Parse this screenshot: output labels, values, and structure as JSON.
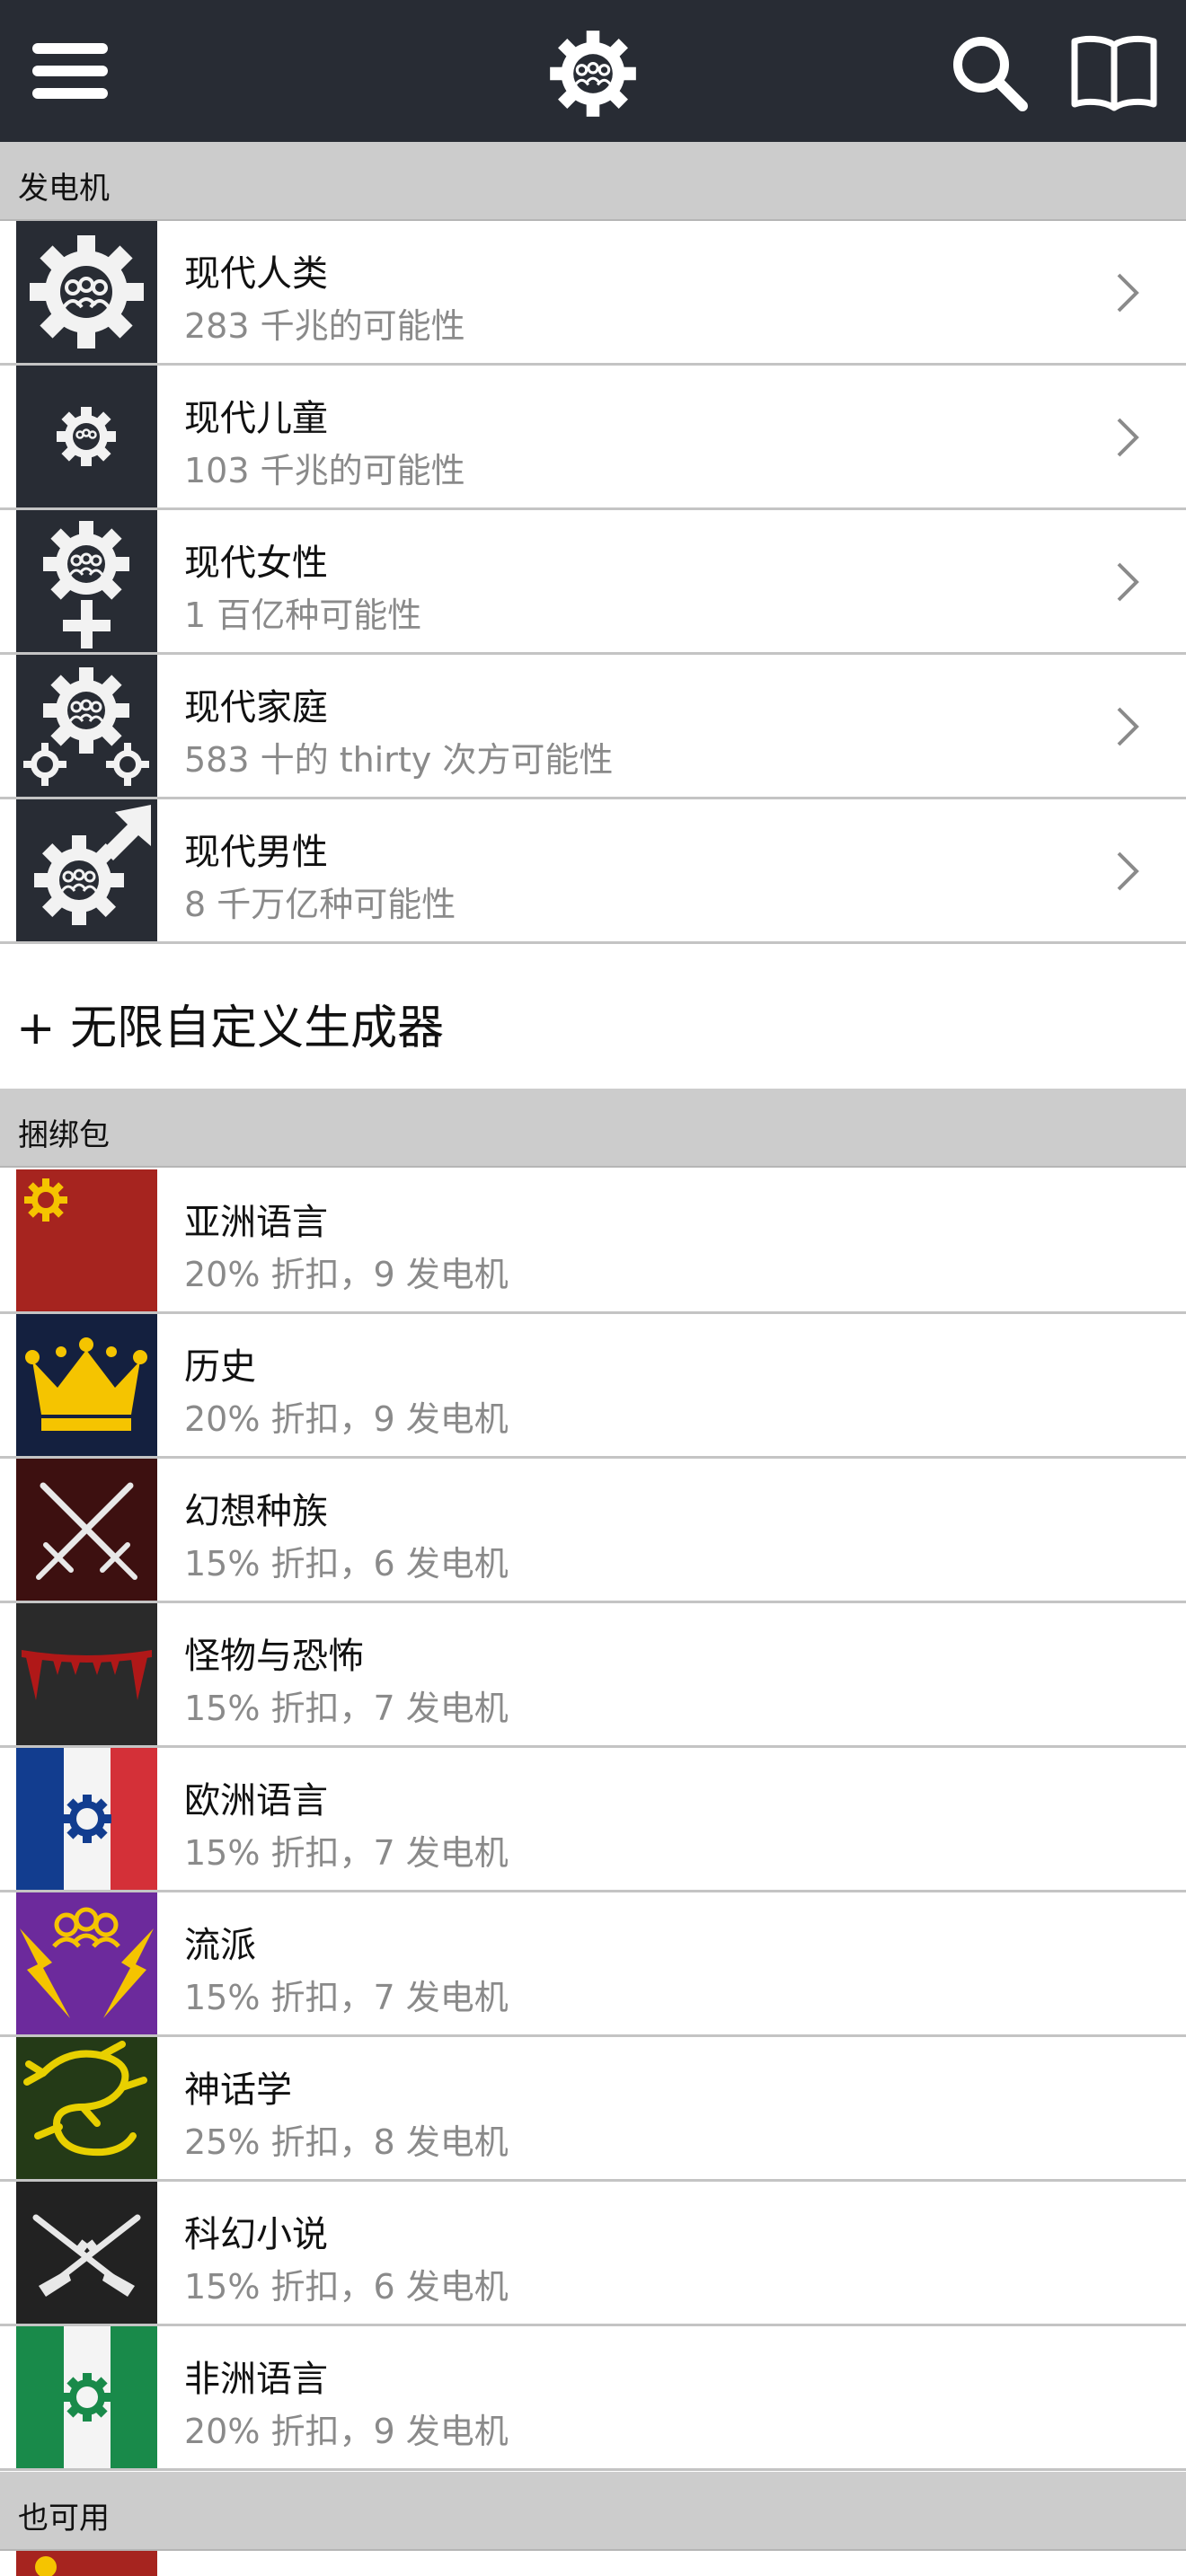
{
  "sections": {
    "generators": "发电机",
    "bundles": "捆绑包",
    "also_available": "也可用"
  },
  "generators": [
    {
      "title": "现代人类",
      "subtitle": "283 千兆的可能性",
      "icon": "gear-people-icon"
    },
    {
      "title": "现代儿童",
      "subtitle": "103 千兆的可能性",
      "icon": "small-gear-icon"
    },
    {
      "title": "现代女性",
      "subtitle": "1 百亿种可能性",
      "icon": "female-gear-icon"
    },
    {
      "title": "现代家庭",
      "subtitle": "583 十的 thirty 次方可能性",
      "icon": "family-gears-icon"
    },
    {
      "title": "现代男性",
      "subtitle": "8 千万亿种可能性",
      "icon": "male-gear-icon"
    }
  ],
  "custom_generator": "+ 无限自定义生成器",
  "bundles": [
    {
      "title": "亚洲语言",
      "subtitle": "20% 折扣，9 发电机",
      "icon": "asian-flag-icon"
    },
    {
      "title": "历史",
      "subtitle": "20% 折扣，9 发电机",
      "icon": "crown-icon"
    },
    {
      "title": "幻想种族",
      "subtitle": "15% 折扣，6 发电机",
      "icon": "crossed-swords-icon"
    },
    {
      "title": "怪物与恐怖",
      "subtitle": "15% 折扣，7 发电机",
      "icon": "fangs-icon"
    },
    {
      "title": "欧洲语言",
      "subtitle": "15% 折扣，7 发电机",
      "icon": "european-flag-icon"
    },
    {
      "title": "流派",
      "subtitle": "15% 折扣，7 发电机",
      "icon": "lightning-icon"
    },
    {
      "title": "神话学",
      "subtitle": "25% 折扣，8 发电机",
      "icon": "dragon-icon"
    },
    {
      "title": "科幻小说",
      "subtitle": "15% 折扣，6 发电机",
      "icon": "crossed-rifles-icon"
    },
    {
      "title": "非洲语言",
      "subtitle": "20% 折扣，9 发电机",
      "icon": "african-flag-icon"
    }
  ],
  "colors": {
    "topbar": "#282c34",
    "section_header": "#cccccc",
    "asian": "#a6241f",
    "history": "#14203f",
    "fantasy": "#3d1010",
    "monsters": "#2a2a2a",
    "european_blue": "#123d8f",
    "european_red": "#d43038",
    "genres": "#6c2a9c",
    "mythology": "#243a17",
    "scifi": "#222222",
    "african": "#198a4a",
    "gold": "#f5c400"
  }
}
